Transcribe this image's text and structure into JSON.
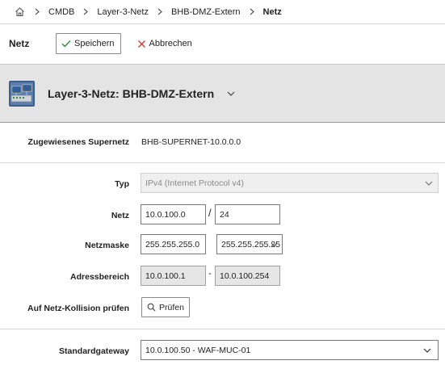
{
  "breadcrumb": {
    "items": [
      "CMDB",
      "Layer-3-Netz",
      "BHB-DMZ-Extern",
      "Netz"
    ]
  },
  "toolbar": {
    "title": "Netz",
    "save_label": "Speichern",
    "cancel_label": "Abbrechen"
  },
  "header": {
    "title": "Layer-3-Netz: BHB-DMZ-Extern"
  },
  "form": {
    "supernet": {
      "label": "Zugewiesenes Supernetz",
      "value": "BHB-SUPERNET-10.0.0.0"
    },
    "typ": {
      "label": "Typ",
      "value": "IPv4 (Internet Protocol v4)"
    },
    "netz": {
      "label": "Netz",
      "address": "10.0.100.0",
      "separator": "/",
      "prefix": "24"
    },
    "netzmaske": {
      "label": "Netzmaske",
      "value": "255.255.255.0",
      "select_value": "255.255.255.25"
    },
    "adressbereich": {
      "label": "Adressbereich",
      "from": "10.0.100.1",
      "separator": "-",
      "to": "10.0.100.254"
    },
    "kollision": {
      "label": "Auf Netz-Kollision prüfen",
      "button_label": "Prüfen"
    },
    "gateway": {
      "label": "Standardgateway",
      "value": "10.0.100.50 - WAF-MUC-01"
    }
  },
  "colors": {
    "save_check": "#2e8b3a",
    "cancel_x": "#d9342b",
    "header_bg": "#e4e4e4"
  },
  "icons": {
    "home": "home-icon",
    "crumb_separator": "chevron-right-icon",
    "save": "checkmark-icon",
    "cancel": "close-icon",
    "network": "network-computers-icon",
    "dropdown": "chevron-down-icon",
    "search": "search-icon"
  }
}
